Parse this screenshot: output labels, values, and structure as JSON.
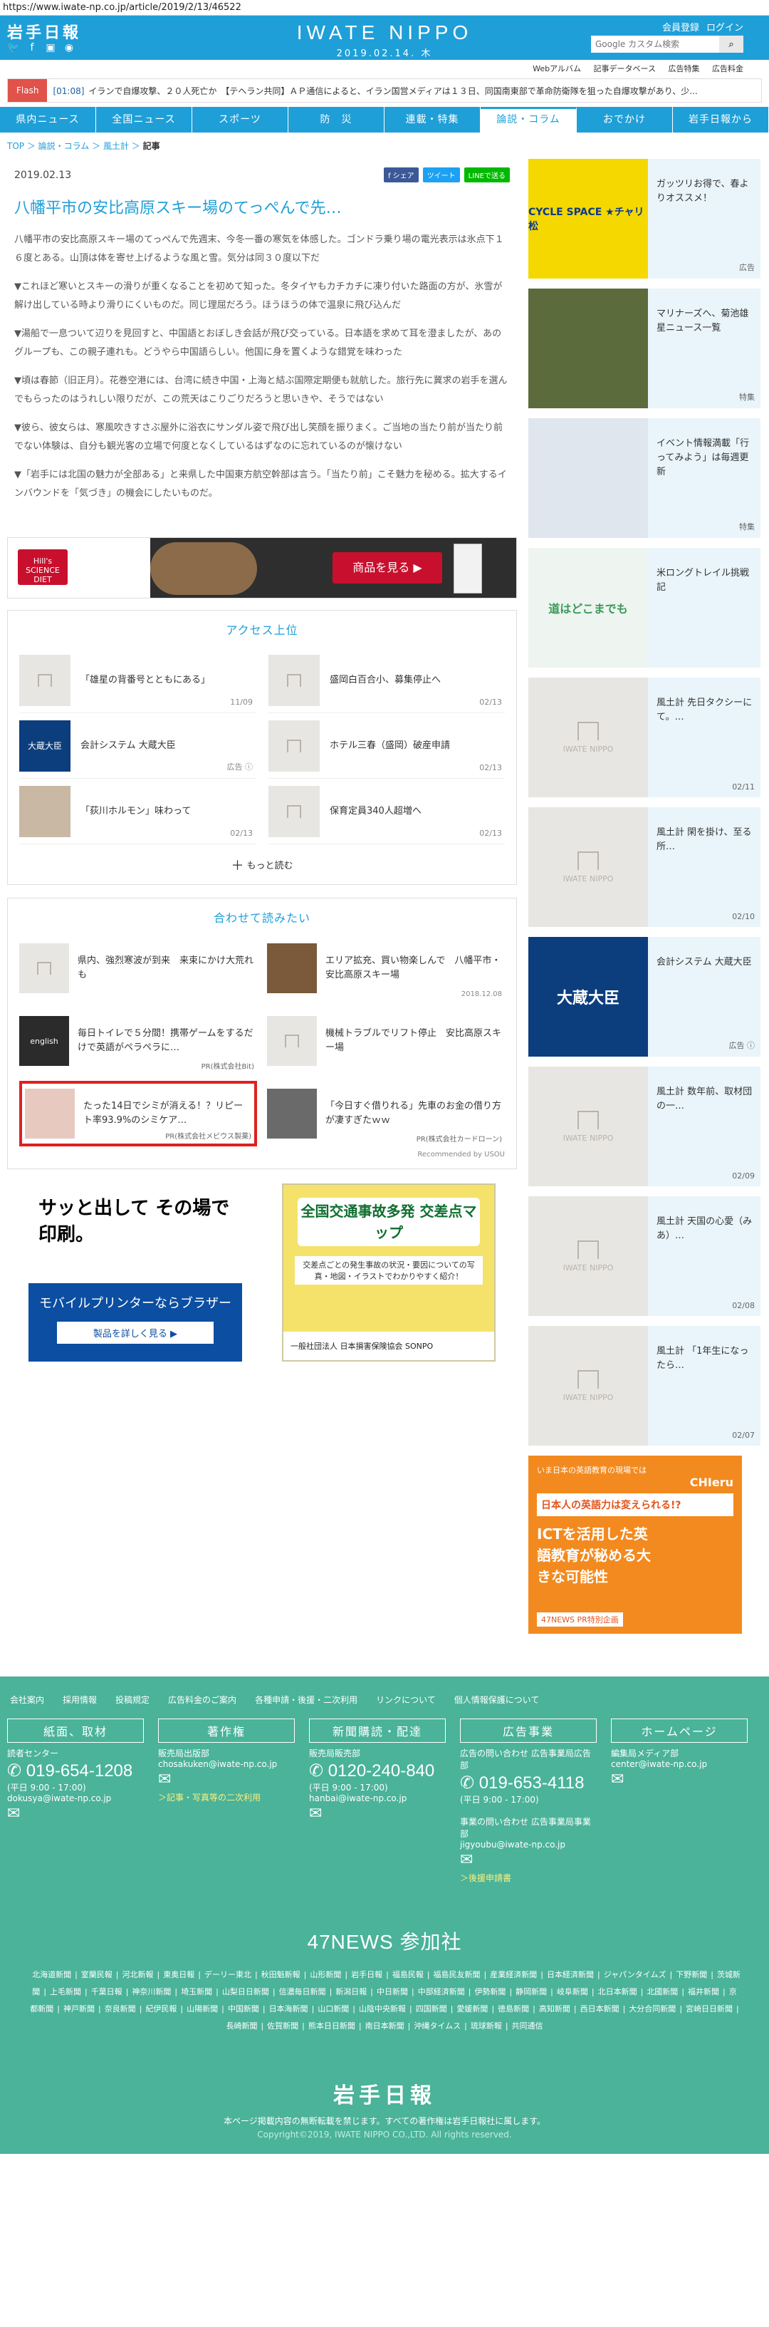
{
  "browser": {
    "url": "https://www.iwate-np.co.jp/article/2019/2/13/46522"
  },
  "header": {
    "logo_jp": "岩手日報",
    "brand": "IWATE NIPPO",
    "date": "2019.02.14. 木",
    "member_links": [
      "会員登録",
      "ログイン"
    ],
    "search_placeholder": "Google カスタム検索",
    "sublinks": [
      "Webアルバム",
      "記事データベース",
      "広告特集",
      "広告料金"
    ]
  },
  "flash": {
    "tag": "Flash",
    "time": "[01:08]",
    "text": "イランで自爆攻撃、２０人死亡か　【テヘラン共同】ＡＰ通信によると、イラン国営メディアは１３日、同国南東部で革命防衛隊を狙った自爆攻撃があり、少..."
  },
  "nav": [
    "県内ニュース",
    "全国ニュース",
    "スポーツ",
    "防　災",
    "連載・特集",
    "論説・コラム",
    "おでかけ",
    "岩手日報から"
  ],
  "nav_active_index": 5,
  "breadcrumb": [
    "TOP",
    "論説・コラム",
    "風土計",
    "記事"
  ],
  "article": {
    "date": "2019.02.13",
    "share": [
      "f シェア",
      "ツイート",
      "LINEで送る"
    ],
    "title": "八幡平市の安比高原スキー場のてっぺんで先…",
    "paragraphs": [
      "八幡平市の安比高原スキー場のてっぺんで先週末、今冬一番の寒気を体感した。ゴンドラ乗り場の電光表示は氷点下１６度とある。山頂は体を寄せ上げるような風と雪。気分は同３０度以下だ",
      "▼これほど寒いとスキーの滑りが重くなることを初めて知った。冬タイヤもカチカチに凍り付いた路面の方が、氷雪が解け出している時より滑りにくいものだ。同じ理屈だろう。ほうほうの体で温泉に飛び込んだ",
      "▼湯船で一息ついて辺りを見回すと、中国語とおぼしき会話が飛び交っている。日本語を求めて耳を澄ましたが、あのグループも、この親子連れも。どうやら中国語らしい。他国に身を置くような錯覚を味わった",
      "▼頃は春節（旧正月）。花巻空港には、台湾に続き中国・上海と結ぶ国際定期便も就航した。旅行先に冀求の岩手を選んでもらったのはうれしい限りだが、この荒天はこりごりだろうと思いきや、そうではない",
      "▼彼ら、彼女らは、寒風吹きすさぶ屋外に浴衣にサンダル姿で飛び出し笑顔を振りまく。ご当地の当たり前が当たり前でない体験は、自分も観光客の立場で何度となくしているはずなのに忘れているのが懐けない",
      "▼「岩手には北国の魅力が全部ある」と来県した中国東方航空幹部は言う。「当たり前」こそ魅力を秘める。拡大するインバウンドを「気づき」の機会にしたいものだ。"
    ]
  },
  "ad_banner": {
    "brand": "Hill's SCIENCE DIET",
    "button": "商品を見る ▶"
  },
  "ranking": {
    "title": "アクセス上位",
    "items": [
      {
        "title": "「雄星の背番号とともにある」",
        "date": "11/09"
      },
      {
        "title": "盛岡白百合小、募集停止へ",
        "date": "02/13"
      },
      {
        "title": "会計システム 大蔵大臣",
        "date": "広告 ⓘ"
      },
      {
        "title": "ホテル三春（盛岡）破産申請",
        "date": "02/13"
      },
      {
        "title": "「荻川ホルモン」味わって",
        "date": "02/13"
      },
      {
        "title": "保育定員340人超増へ",
        "date": "02/13"
      }
    ],
    "more": "もっと読む"
  },
  "recommend": {
    "title": "合わせて読みたい",
    "items": [
      {
        "title": "県内、強烈寒波が到来　来束にかけ大荒れも",
        "meta": ""
      },
      {
        "title": "エリア拡充、買い物楽しんで　八幡平市・安比高原スキー場",
        "meta": "2018.12.08"
      },
      {
        "title": "毎日トイレで５分間！携帯ゲームをするだけで英語がペラペラに…",
        "meta": "PR(株式会社Bit)"
      },
      {
        "title": "機械トラブルでリフト停止　安比高原スキー場",
        "meta": ""
      },
      {
        "title": "たった14日でシミが消える！？リピート率93.9%のシミケア…",
        "meta": "PR(株式会社メビウス製薬)"
      },
      {
        "title": "「今日すぐ借りれる」先車のお金の借り方が凄すぎたｗｗ",
        "meta": "PR(株式会社カードローン)"
      }
    ],
    "recommended_by": "Recommended by USOU"
  },
  "ads_bottom": {
    "brother": {
      "headline": "サッと出して その場で印刷。",
      "sub": "モバイルプリンターならブラザー",
      "button": "製品を詳しく見る ▶"
    },
    "sonpo": {
      "headline": "全国交通事故多発 交差点マップ",
      "sub": "交差点ごとの発生事故の状況・要因についての写真・地図・イラストでわかりやすく紹介！",
      "footer": "一般社団法人 日本損害保険協会 SONPO"
    }
  },
  "sidebar": [
    {
      "title": "ガッツリお得で、春よりオススメ！",
      "meta": "広告",
      "img": "CYCLE SPACE ★チャリ松",
      "bg": "#f5d800"
    },
    {
      "title": "マリナーズへ、菊池雄星ニュース一覧",
      "meta": "特集",
      "img": "",
      "bg": "#5b6b3c"
    },
    {
      "title": "イベント情報満載「行ってみよう」は毎週更新",
      "meta": "特集",
      "img": "",
      "bg": "#dfe6ee"
    },
    {
      "title": "米ロングトレイル挑戦記",
      "meta": "",
      "img": "道はどこまでも",
      "bg": "#e9f0f4"
    },
    {
      "title": "風土計 先日タクシーにて。…",
      "meta": "02/11",
      "img": "IWATE NIPPO",
      "bg": "#e8e6e2"
    },
    {
      "title": "風土計 閑を掛け、至る所…",
      "meta": "02/10",
      "img": "IWATE NIPPO",
      "bg": "#e8e6e2"
    },
    {
      "title": "会計システム 大蔵大臣",
      "meta": "広告 ⓘ",
      "img": "大蔵大臣",
      "bg": "#0c3e7e"
    },
    {
      "title": "風土計 数年前、取材団の一…",
      "meta": "02/09",
      "img": "IWATE NIPPO",
      "bg": "#e8e6e2"
    },
    {
      "title": "風土計 天国の心愛（みあ）…",
      "meta": "02/08",
      "img": "IWATE NIPPO",
      "bg": "#e8e6e2"
    },
    {
      "title": "風土計 「1年生になったら…",
      "meta": "02/07",
      "img": "IWATE NIPPO",
      "bg": "#e8e6e2"
    }
  ],
  "side_ad": {
    "headline": "いま日本の英語教育の現場では",
    "brand": "CHIeru",
    "main": "日本人の英語力は変えられる!?",
    "sub": "ICTを活用した英語教育が秘める大きな可能性",
    "footer": "47NEWS PR特別企画"
  },
  "footer": {
    "links": [
      "会社案内",
      "採用情報",
      "投稿規定",
      "広告料金のご案内",
      "各種申請・後援・二次利用",
      "リンクについて",
      "個人情報保護について"
    ],
    "columns": [
      {
        "head": "紙面、取材",
        "label": "読者センター",
        "tel": "019-654-1208",
        "hours": "(平日 9:00 - 17:00)",
        "mail": "dokusya@iwate-np.co.jp",
        "link": ""
      },
      {
        "head": "著作権",
        "label": "販売局出版部",
        "tel": "",
        "hours": "",
        "mail": "chosakuken@iwate-np.co.jp",
        "link": "＞記事・写真等の二次利用"
      },
      {
        "head": "新聞購読・配達",
        "label": "販売局販売部",
        "tel": "0120-240-840",
        "hours": "(平日 9:00 - 17:00)",
        "mail": "hanbai@iwate-np.co.jp",
        "link": ""
      },
      {
        "head": "広告事業",
        "label": "広告の問い合わせ 広告事業局広告部",
        "tel": "019-653-4118",
        "hours": "(平日 9:00 - 17:00)",
        "mail": "",
        "link": "",
        "label2": "事業の問い合わせ 広告事業局事業部",
        "mail2": "jigyoubu@iwate-np.co.jp",
        "link2": "＞後援申請書"
      },
      {
        "head": "ホームページ",
        "label": "編集局メディア部",
        "tel": "",
        "hours": "",
        "mail": "center@iwate-np.co.jp",
        "link": ""
      }
    ],
    "news_title": "47NEWS 参加社",
    "news": [
      "北海道新聞",
      "室蘭民報",
      "河北新報",
      "東奥日報",
      "デーリー東北",
      "秋田魁新報",
      "山形新聞",
      "岩手日報",
      "福島民報",
      "福島民友新聞",
      "産業経済新聞",
      "日本経済新聞",
      "ジャパンタイムズ",
      "下野新聞",
      "茨城新聞",
      "上毛新聞",
      "千葉日報",
      "神奈川新聞",
      "埼玉新聞",
      "山梨日日新聞",
      "信濃毎日新聞",
      "新潟日報",
      "中日新聞",
      "中部経済新聞",
      "伊勢新聞",
      "静岡新聞",
      "岐阜新聞",
      "北日本新聞",
      "北國新聞",
      "福井新聞",
      "京都新聞",
      "神戸新聞",
      "奈良新聞",
      "紀伊民報",
      "山陽新聞",
      "中国新聞",
      "日本海新聞",
      "山口新聞",
      "山陰中央新報",
      "四国新聞",
      "愛媛新聞",
      "徳島新聞",
      "高知新聞",
      "西日本新聞",
      "大分合同新聞",
      "宮崎日日新聞",
      "長崎新聞",
      "佐賀新聞",
      "熊本日日新聞",
      "南日本新聞",
      "沖縄タイムス",
      "琉球新報",
      "共同通信"
    ],
    "logo": "岩手日報",
    "note": "本ページ掲載内容の無断転載を禁じます。すべての著作権は岩手日報社に属します。",
    "copyright": "Copyright©2019, IWATE NIPPO CO.,LTD. All rights reserved."
  }
}
